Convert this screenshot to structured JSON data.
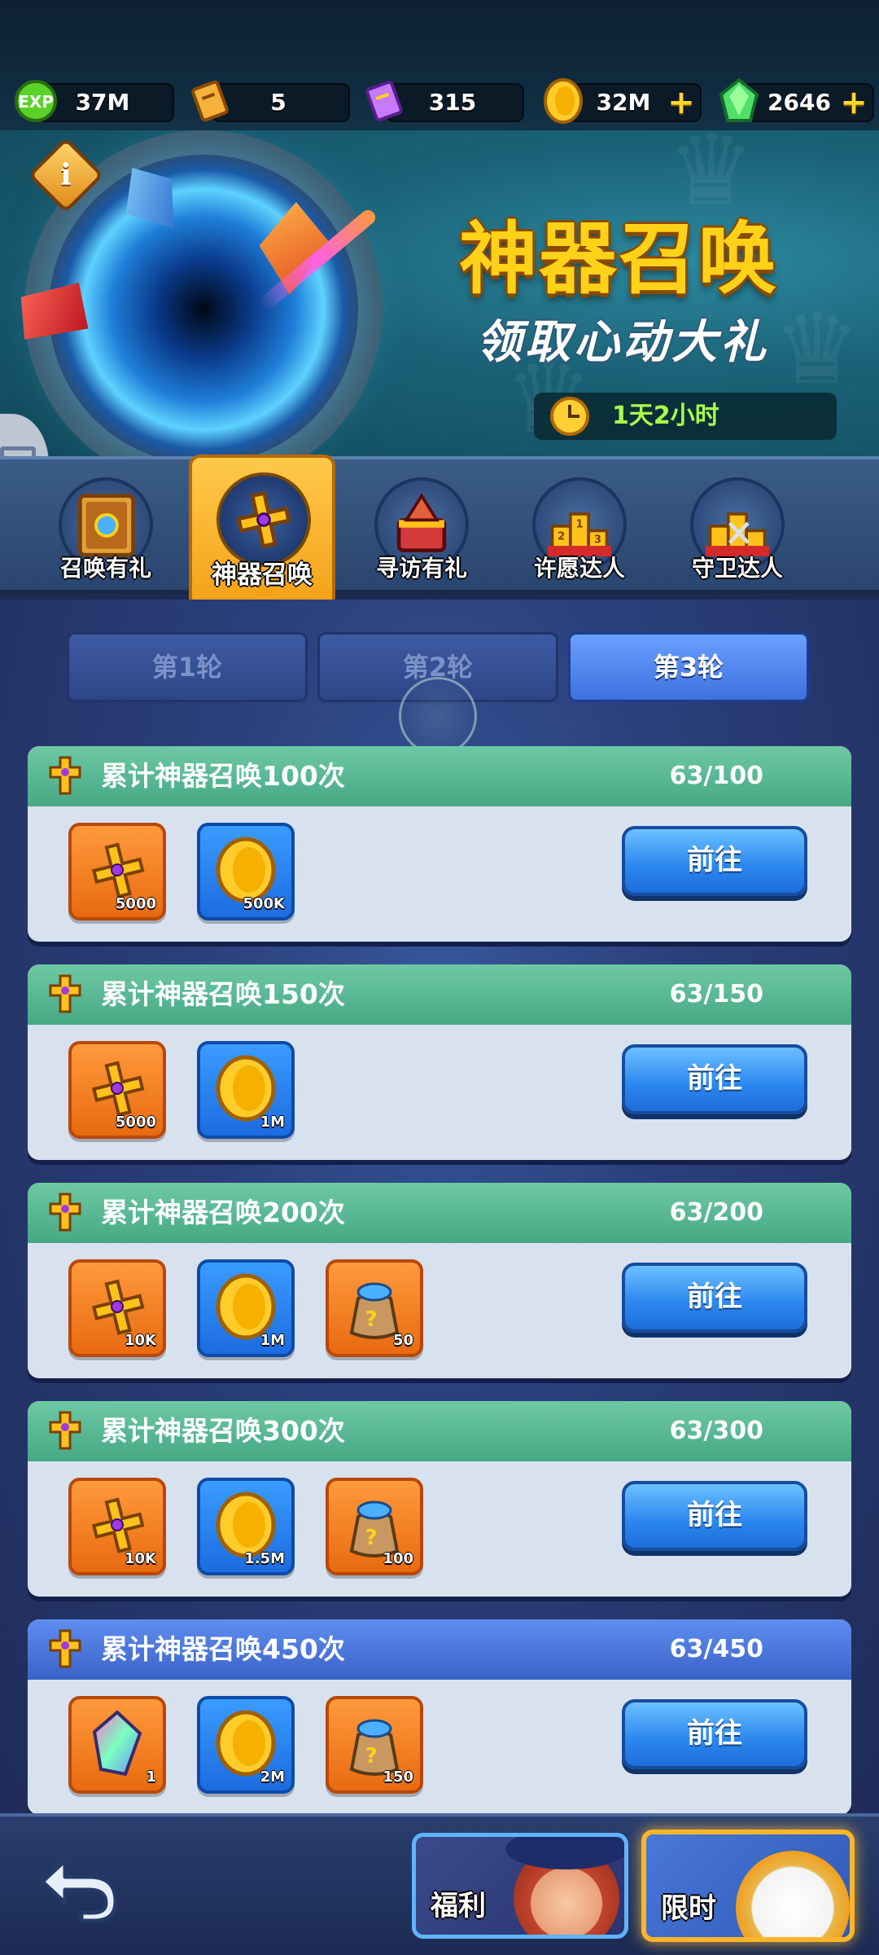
{
  "resources": [
    {
      "name": "exp-icon",
      "value": "37M",
      "plus": false
    },
    {
      "name": "scroll-icon",
      "value": "5",
      "plus": false
    },
    {
      "name": "purple-scroll-icon",
      "value": "315",
      "plus": false
    },
    {
      "name": "gold-coin-icon",
      "value": "32M",
      "plus": true
    },
    {
      "name": "green-gem-icon",
      "value": "2646",
      "plus": true
    }
  ],
  "banner": {
    "title": "神器召唤",
    "subtitle": "领取心动大礼",
    "timer": "1天2小时",
    "info_icon": "info-icon"
  },
  "tabs": [
    {
      "label": "召唤有礼",
      "icon": "spellbook-icon",
      "active": false
    },
    {
      "label": "神器召唤",
      "icon": "golden-cross-artifact-icon",
      "active": true
    },
    {
      "label": "寻访有礼",
      "icon": "dragon-chest-icon",
      "active": false
    },
    {
      "label": "许愿达人",
      "icon": "podium-trophy-icon",
      "active": false
    },
    {
      "label": "守卫达人",
      "icon": "podium-swords-icon",
      "active": false
    }
  ],
  "rounds": [
    {
      "label": "第1轮",
      "active": false
    },
    {
      "label": "第2轮",
      "active": false
    },
    {
      "label": "第3轮",
      "active": true
    }
  ],
  "tasks": [
    {
      "title": "累计神器召唤100次",
      "progress": "63/100",
      "button": "前往",
      "header": "green",
      "rewards": [
        {
          "icon": "golden-cross-icon",
          "qty": "5000",
          "frame": "orange"
        },
        {
          "icon": "gold-coin-icon",
          "qty": "500K",
          "frame": "blue"
        }
      ]
    },
    {
      "title": "累计神器召唤150次",
      "progress": "63/150",
      "button": "前往",
      "header": "green",
      "rewards": [
        {
          "icon": "golden-cross-icon",
          "qty": "5000",
          "frame": "orange"
        },
        {
          "icon": "gold-coin-icon",
          "qty": "1M",
          "frame": "blue"
        }
      ]
    },
    {
      "title": "累计神器召唤200次",
      "progress": "63/200",
      "button": "前往",
      "header": "green",
      "rewards": [
        {
          "icon": "golden-cross-icon",
          "qty": "10K",
          "frame": "orange"
        },
        {
          "icon": "gold-coin-icon",
          "qty": "1M",
          "frame": "blue"
        },
        {
          "icon": "mystery-bag-icon",
          "qty": "50",
          "frame": "orange"
        }
      ]
    },
    {
      "title": "累计神器召唤300次",
      "progress": "63/300",
      "button": "前往",
      "header": "green",
      "rewards": [
        {
          "icon": "golden-cross-icon",
          "qty": "10K",
          "frame": "orange"
        },
        {
          "icon": "gold-coin-icon",
          "qty": "1.5M",
          "frame": "blue"
        },
        {
          "icon": "mystery-bag-icon",
          "qty": "100",
          "frame": "orange"
        }
      ]
    },
    {
      "title": "累计神器召唤450次",
      "progress": "63/450",
      "button": "前往",
      "header": "blue",
      "rewards": [
        {
          "icon": "rainbow-crystal-icon",
          "qty": "1",
          "frame": "orange"
        },
        {
          "icon": "gold-coin-icon",
          "qty": "2M",
          "frame": "blue"
        },
        {
          "icon": "mystery-bag-icon",
          "qty": "150",
          "frame": "orange"
        }
      ]
    }
  ],
  "bottom": {
    "back_icon": "back-arrow-icon",
    "welfare_label": "福利",
    "limited_label": "限时"
  },
  "colors": {
    "header_green": "#47a884",
    "header_blue": "#3a62c8",
    "accent_gold": "#ffd21a",
    "button_blue": "#2a86ee"
  }
}
